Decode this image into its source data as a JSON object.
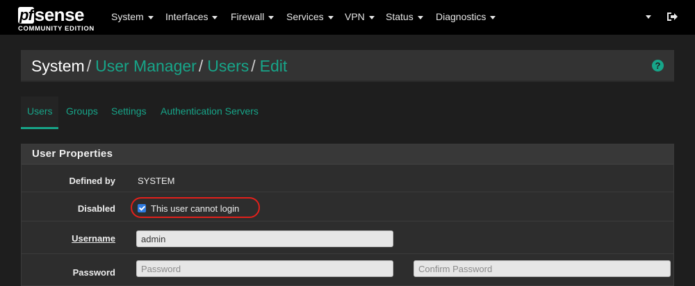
{
  "brand": {
    "logo_pf": "pf",
    "logo_sense": "sense",
    "edition": "COMMUNITY EDITION"
  },
  "nav": {
    "items": [
      {
        "label": "System"
      },
      {
        "label": "Interfaces"
      },
      {
        "label": "Firewall"
      },
      {
        "label": "Services"
      },
      {
        "label": "VPN"
      },
      {
        "label": "Status"
      },
      {
        "label": "Diagnostics"
      }
    ],
    "logout_icon": "sign-out-icon"
  },
  "breadcrumb": {
    "root": "System",
    "links": [
      "User Manager",
      "Users",
      "Edit"
    ],
    "separator": "/",
    "help_icon": "?"
  },
  "tabs": [
    {
      "label": "Users",
      "active": true
    },
    {
      "label": "Groups",
      "active": false
    },
    {
      "label": "Settings",
      "active": false
    },
    {
      "label": "Authentication Servers",
      "active": false
    }
  ],
  "panel": {
    "title": "User Properties",
    "defined_by": {
      "label": "Defined by",
      "value": "SYSTEM"
    },
    "disabled": {
      "label": "Disabled",
      "checkbox_label": "This user cannot login",
      "checked": true
    },
    "username": {
      "label": "Username",
      "value": "admin"
    },
    "password": {
      "label": "Password",
      "placeholder": "Password",
      "confirm_placeholder": "Confirm Password"
    }
  },
  "colors": {
    "accent": "#17a589",
    "navbar": "#000000",
    "background": "#1e1e1e",
    "highlight": "#e3201b",
    "checkbox": "#2f7be0"
  }
}
